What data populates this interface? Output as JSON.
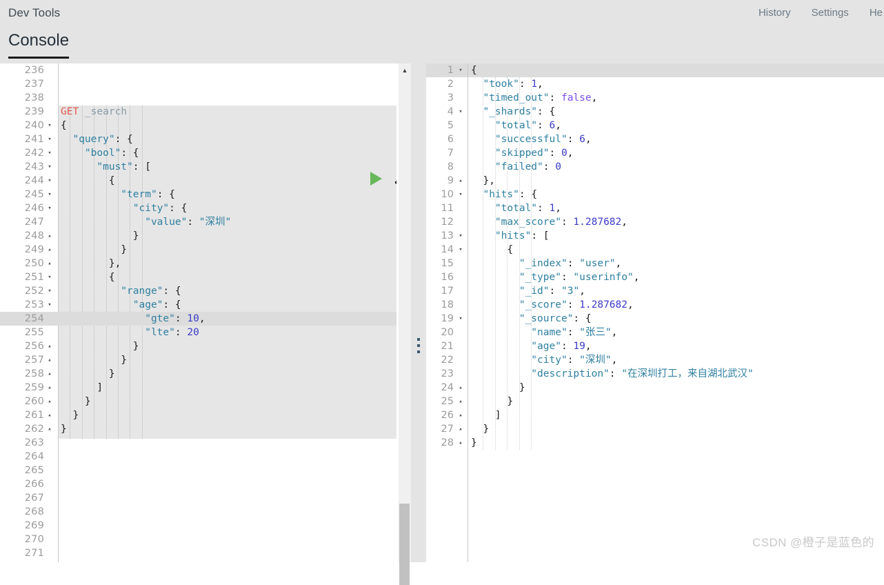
{
  "header": {
    "app_title": "Dev Tools",
    "nav": [
      {
        "label": "History"
      },
      {
        "label": "Settings"
      },
      {
        "label": "He"
      }
    ]
  },
  "tabs": {
    "active": "Console"
  },
  "editor": {
    "first_line_number": 236,
    "active_line_number": 254,
    "run_icon": "play-icon",
    "tools_icon": "wrench-icon",
    "scroll_up_icon": "caret-up-icon",
    "lines": [
      {
        "n": 236,
        "fold": "",
        "tokens": []
      },
      {
        "n": 237,
        "fold": "",
        "tokens": []
      },
      {
        "n": 238,
        "fold": "",
        "tokens": []
      },
      {
        "n": 239,
        "fold": "",
        "tokens": [
          {
            "t": "method",
            "v": "GET"
          },
          {
            "t": "plain",
            "v": " "
          },
          {
            "t": "path",
            "v": "_search"
          }
        ]
      },
      {
        "n": 240,
        "fold": "▾",
        "tokens": [
          {
            "t": "brace",
            "v": "{"
          }
        ]
      },
      {
        "n": 241,
        "fold": "▾",
        "tokens": [
          {
            "t": "key",
            "v": "  \"query\""
          },
          {
            "t": "punct",
            "v": ": "
          },
          {
            "t": "brace",
            "v": "{"
          }
        ]
      },
      {
        "n": 242,
        "fold": "▾",
        "tokens": [
          {
            "t": "key",
            "v": "    \"bool\""
          },
          {
            "t": "punct",
            "v": ": "
          },
          {
            "t": "brace",
            "v": "{"
          }
        ]
      },
      {
        "n": 243,
        "fold": "▾",
        "tokens": [
          {
            "t": "key",
            "v": "      \"must\""
          },
          {
            "t": "punct",
            "v": ": "
          },
          {
            "t": "brace",
            "v": "["
          }
        ]
      },
      {
        "n": 244,
        "fold": "▾",
        "tokens": [
          {
            "t": "brace",
            "v": "        {"
          }
        ]
      },
      {
        "n": 245,
        "fold": "▾",
        "tokens": [
          {
            "t": "key",
            "v": "          \"term\""
          },
          {
            "t": "punct",
            "v": ": "
          },
          {
            "t": "brace",
            "v": "{"
          }
        ]
      },
      {
        "n": 246,
        "fold": "▾",
        "tokens": [
          {
            "t": "key",
            "v": "            \"city\""
          },
          {
            "t": "punct",
            "v": ": "
          },
          {
            "t": "brace",
            "v": "{"
          }
        ]
      },
      {
        "n": 247,
        "fold": "",
        "tokens": [
          {
            "t": "key",
            "v": "              \"value\""
          },
          {
            "t": "punct",
            "v": ": "
          },
          {
            "t": "str",
            "v": "\"深圳\""
          }
        ]
      },
      {
        "n": 248,
        "fold": "▴",
        "tokens": [
          {
            "t": "brace",
            "v": "            }"
          }
        ]
      },
      {
        "n": 249,
        "fold": "▴",
        "tokens": [
          {
            "t": "brace",
            "v": "          }"
          }
        ]
      },
      {
        "n": 250,
        "fold": "▴",
        "tokens": [
          {
            "t": "brace",
            "v": "        }"
          },
          {
            "t": "punct",
            "v": ","
          }
        ]
      },
      {
        "n": 251,
        "fold": "▾",
        "tokens": [
          {
            "t": "brace",
            "v": "        {"
          }
        ]
      },
      {
        "n": 252,
        "fold": "▾",
        "tokens": [
          {
            "t": "key",
            "v": "          \"range\""
          },
          {
            "t": "punct",
            "v": ": "
          },
          {
            "t": "brace",
            "v": "{"
          }
        ]
      },
      {
        "n": 253,
        "fold": "▾",
        "tokens": [
          {
            "t": "key",
            "v": "            \"age\""
          },
          {
            "t": "punct",
            "v": ": "
          },
          {
            "t": "brace",
            "v": "{"
          }
        ]
      },
      {
        "n": 254,
        "fold": "",
        "tokens": [
          {
            "t": "key",
            "v": "              \"gte\""
          },
          {
            "t": "punct",
            "v": ": "
          },
          {
            "t": "num",
            "v": "10"
          },
          {
            "t": "punct",
            "v": ","
          }
        ]
      },
      {
        "n": 255,
        "fold": "",
        "tokens": [
          {
            "t": "key",
            "v": "              \"lte\""
          },
          {
            "t": "punct",
            "v": ": "
          },
          {
            "t": "num",
            "v": "20"
          }
        ]
      },
      {
        "n": 256,
        "fold": "▴",
        "tokens": [
          {
            "t": "brace",
            "v": "            }"
          }
        ]
      },
      {
        "n": 257,
        "fold": "▴",
        "tokens": [
          {
            "t": "brace",
            "v": "          }"
          }
        ]
      },
      {
        "n": 258,
        "fold": "▴",
        "tokens": [
          {
            "t": "brace",
            "v": "        }"
          }
        ]
      },
      {
        "n": 259,
        "fold": "▴",
        "tokens": [
          {
            "t": "brace",
            "v": "      ]"
          }
        ]
      },
      {
        "n": 260,
        "fold": "▴",
        "tokens": [
          {
            "t": "brace",
            "v": "    }"
          }
        ]
      },
      {
        "n": 261,
        "fold": "▴",
        "tokens": [
          {
            "t": "brace",
            "v": "  }"
          }
        ]
      },
      {
        "n": 262,
        "fold": "▴",
        "tokens": [
          {
            "t": "brace",
            "v": "}"
          }
        ]
      },
      {
        "n": 263,
        "fold": "",
        "tokens": []
      },
      {
        "n": 264,
        "fold": "",
        "tokens": []
      },
      {
        "n": 265,
        "fold": "",
        "tokens": []
      },
      {
        "n": 266,
        "fold": "",
        "tokens": []
      },
      {
        "n": 267,
        "fold": "",
        "tokens": []
      },
      {
        "n": 268,
        "fold": "",
        "tokens": []
      },
      {
        "n": 269,
        "fold": "",
        "tokens": []
      },
      {
        "n": 270,
        "fold": "",
        "tokens": []
      },
      {
        "n": 271,
        "fold": "",
        "tokens": []
      }
    ]
  },
  "response": {
    "active_line_number": 1,
    "lines": [
      {
        "n": 1,
        "fold": "▾",
        "tokens": [
          {
            "t": "brace",
            "v": "{"
          }
        ]
      },
      {
        "n": 2,
        "fold": "",
        "tokens": [
          {
            "t": "key",
            "v": "  \"took\""
          },
          {
            "t": "punct",
            "v": ": "
          },
          {
            "t": "num",
            "v": "1"
          },
          {
            "t": "punct",
            "v": ","
          }
        ]
      },
      {
        "n": 3,
        "fold": "",
        "tokens": [
          {
            "t": "key",
            "v": "  \"timed_out\""
          },
          {
            "t": "punct",
            "v": ": "
          },
          {
            "t": "bool",
            "v": "false"
          },
          {
            "t": "punct",
            "v": ","
          }
        ]
      },
      {
        "n": 4,
        "fold": "▾",
        "tokens": [
          {
            "t": "key",
            "v": "  \"_shards\""
          },
          {
            "t": "punct",
            "v": ": "
          },
          {
            "t": "brace",
            "v": "{"
          }
        ]
      },
      {
        "n": 5,
        "fold": "",
        "tokens": [
          {
            "t": "key",
            "v": "    \"total\""
          },
          {
            "t": "punct",
            "v": ": "
          },
          {
            "t": "num",
            "v": "6"
          },
          {
            "t": "punct",
            "v": ","
          }
        ]
      },
      {
        "n": 6,
        "fold": "",
        "tokens": [
          {
            "t": "key",
            "v": "    \"successful\""
          },
          {
            "t": "punct",
            "v": ": "
          },
          {
            "t": "num",
            "v": "6"
          },
          {
            "t": "punct",
            "v": ","
          }
        ]
      },
      {
        "n": 7,
        "fold": "",
        "tokens": [
          {
            "t": "key",
            "v": "    \"skipped\""
          },
          {
            "t": "punct",
            "v": ": "
          },
          {
            "t": "num",
            "v": "0"
          },
          {
            "t": "punct",
            "v": ","
          }
        ]
      },
      {
        "n": 8,
        "fold": "",
        "tokens": [
          {
            "t": "key",
            "v": "    \"failed\""
          },
          {
            "t": "punct",
            "v": ": "
          },
          {
            "t": "num",
            "v": "0"
          }
        ]
      },
      {
        "n": 9,
        "fold": "▴",
        "tokens": [
          {
            "t": "brace",
            "v": "  }"
          },
          {
            "t": "punct",
            "v": ","
          }
        ]
      },
      {
        "n": 10,
        "fold": "▾",
        "tokens": [
          {
            "t": "key",
            "v": "  \"hits\""
          },
          {
            "t": "punct",
            "v": ": "
          },
          {
            "t": "brace",
            "v": "{"
          }
        ]
      },
      {
        "n": 11,
        "fold": "",
        "tokens": [
          {
            "t": "key",
            "v": "    \"total\""
          },
          {
            "t": "punct",
            "v": ": "
          },
          {
            "t": "num",
            "v": "1"
          },
          {
            "t": "punct",
            "v": ","
          }
        ]
      },
      {
        "n": 12,
        "fold": "",
        "tokens": [
          {
            "t": "key",
            "v": "    \"max_score\""
          },
          {
            "t": "punct",
            "v": ": "
          },
          {
            "t": "num",
            "v": "1.287682"
          },
          {
            "t": "punct",
            "v": ","
          }
        ]
      },
      {
        "n": 13,
        "fold": "▾",
        "tokens": [
          {
            "t": "key",
            "v": "    \"hits\""
          },
          {
            "t": "punct",
            "v": ": "
          },
          {
            "t": "brace",
            "v": "["
          }
        ]
      },
      {
        "n": 14,
        "fold": "▾",
        "tokens": [
          {
            "t": "brace",
            "v": "      {"
          }
        ]
      },
      {
        "n": 15,
        "fold": "",
        "tokens": [
          {
            "t": "key",
            "v": "        \"_index\""
          },
          {
            "t": "punct",
            "v": ": "
          },
          {
            "t": "str",
            "v": "\"user\""
          },
          {
            "t": "punct",
            "v": ","
          }
        ]
      },
      {
        "n": 16,
        "fold": "",
        "tokens": [
          {
            "t": "key",
            "v": "        \"_type\""
          },
          {
            "t": "punct",
            "v": ": "
          },
          {
            "t": "str",
            "v": "\"userinfo\""
          },
          {
            "t": "punct",
            "v": ","
          }
        ]
      },
      {
        "n": 17,
        "fold": "",
        "tokens": [
          {
            "t": "key",
            "v": "        \"_id\""
          },
          {
            "t": "punct",
            "v": ": "
          },
          {
            "t": "str",
            "v": "\"3\""
          },
          {
            "t": "punct",
            "v": ","
          }
        ]
      },
      {
        "n": 18,
        "fold": "",
        "tokens": [
          {
            "t": "key",
            "v": "        \"_score\""
          },
          {
            "t": "punct",
            "v": ": "
          },
          {
            "t": "num",
            "v": "1.287682"
          },
          {
            "t": "punct",
            "v": ","
          }
        ]
      },
      {
        "n": 19,
        "fold": "▾",
        "tokens": [
          {
            "t": "key",
            "v": "        \"_source\""
          },
          {
            "t": "punct",
            "v": ": "
          },
          {
            "t": "brace",
            "v": "{"
          }
        ]
      },
      {
        "n": 20,
        "fold": "",
        "tokens": [
          {
            "t": "key",
            "v": "          \"name\""
          },
          {
            "t": "punct",
            "v": ": "
          },
          {
            "t": "str",
            "v": "\"张三\""
          },
          {
            "t": "punct",
            "v": ","
          }
        ]
      },
      {
        "n": 21,
        "fold": "",
        "tokens": [
          {
            "t": "key",
            "v": "          \"age\""
          },
          {
            "t": "punct",
            "v": ": "
          },
          {
            "t": "num",
            "v": "19"
          },
          {
            "t": "punct",
            "v": ","
          }
        ]
      },
      {
        "n": 22,
        "fold": "",
        "tokens": [
          {
            "t": "key",
            "v": "          \"city\""
          },
          {
            "t": "punct",
            "v": ": "
          },
          {
            "t": "str",
            "v": "\"深圳\""
          },
          {
            "t": "punct",
            "v": ","
          }
        ]
      },
      {
        "n": 23,
        "fold": "",
        "tokens": [
          {
            "t": "key",
            "v": "          \"description\""
          },
          {
            "t": "punct",
            "v": ": "
          },
          {
            "t": "str",
            "v": "\"在深圳打工，来自湖北武汉\""
          }
        ]
      },
      {
        "n": 24,
        "fold": "▴",
        "tokens": [
          {
            "t": "brace",
            "v": "        }"
          }
        ]
      },
      {
        "n": 25,
        "fold": "▴",
        "tokens": [
          {
            "t": "brace",
            "v": "      }"
          }
        ]
      },
      {
        "n": 26,
        "fold": "▴",
        "tokens": [
          {
            "t": "brace",
            "v": "    ]"
          }
        ]
      },
      {
        "n": 27,
        "fold": "▴",
        "tokens": [
          {
            "t": "brace",
            "v": "  }"
          }
        ]
      },
      {
        "n": 28,
        "fold": "▴",
        "tokens": [
          {
            "t": "brace",
            "v": "}"
          }
        ]
      }
    ]
  },
  "watermark": {
    "text": "CSDN @橙子是蓝色的"
  },
  "colors": {
    "chrome": "#e4e4e4",
    "request_block": "#e6e6e6",
    "active_line": "#dcdcdc",
    "method": "#e8584f",
    "key": "#2e7fa0",
    "number": "#3b3bc9",
    "boolean": "#7a4de8",
    "run": "#68b75b"
  }
}
